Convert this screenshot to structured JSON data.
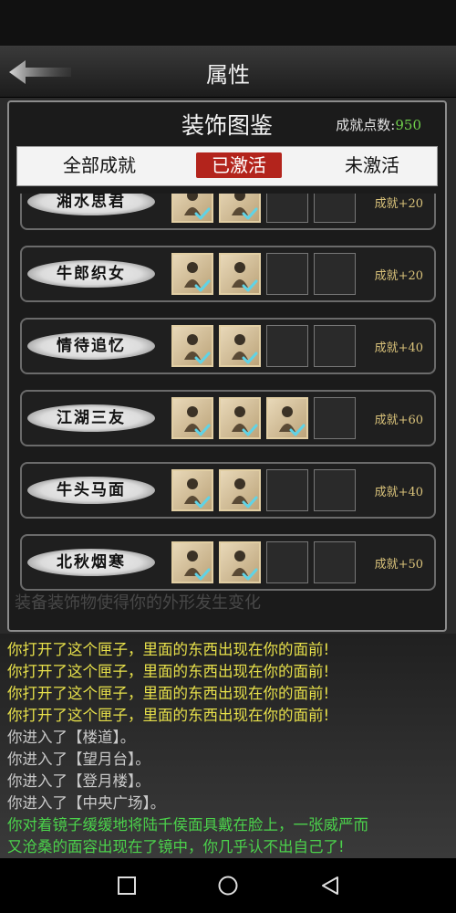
{
  "header": {
    "title": "属性"
  },
  "panel": {
    "title": "装饰图鉴",
    "points_label": "成就点数:",
    "points_value": "950",
    "ghost_text": "装备装饰物使得你的外形发生变化",
    "tabs": [
      {
        "label": "全部成就",
        "active": false
      },
      {
        "label": "已激活",
        "active": true
      },
      {
        "label": "未激活",
        "active": false
      }
    ],
    "rows": [
      {
        "name": "湘水思君",
        "reward": "成就+20",
        "slots": [
          true,
          true,
          false,
          false
        ]
      },
      {
        "name": "牛郎织女",
        "reward": "成就+20",
        "slots": [
          true,
          true,
          false,
          false
        ]
      },
      {
        "name": "情待追忆",
        "reward": "成就+40",
        "slots": [
          true,
          true,
          false,
          false
        ]
      },
      {
        "name": "江湖三友",
        "reward": "成就+60",
        "slots": [
          true,
          true,
          true,
          false
        ]
      },
      {
        "name": "牛头马面",
        "reward": "成就+40",
        "slots": [
          true,
          true,
          false,
          false
        ]
      },
      {
        "name": "北秋烟寒",
        "reward": "成就+50",
        "slots": [
          true,
          true,
          false,
          false
        ]
      }
    ]
  },
  "log": [
    {
      "text": "你打开了这个匣子，里面的东西出现在你的面前!",
      "color": "yellow"
    },
    {
      "text": "你打开了这个匣子，里面的东西出现在你的面前!",
      "color": "yellow"
    },
    {
      "text": "你打开了这个匣子，里面的东西出现在你的面前!",
      "color": "yellow"
    },
    {
      "text": "你打开了这个匣子，里面的东西出现在你的面前!",
      "color": "yellow"
    },
    {
      "text": "你进入了【楼道】。",
      "color": "gray"
    },
    {
      "text": "你进入了【望月台】。",
      "color": "gray"
    },
    {
      "text": "你进入了【登月楼】。",
      "color": "gray"
    },
    {
      "text": "你进入了【中央广场】。",
      "color": "gray"
    },
    {
      "text": "你对着镜子缓缓地将陆千侯面具戴在脸上，一张威严而",
      "color": "green"
    },
    {
      "text": "又沧桑的面容出现在了镜中，你几乎认不出自己了!",
      "color": "green"
    }
  ],
  "navbar": {
    "icons": [
      "recent-apps-icon",
      "home-icon",
      "back-icon"
    ]
  }
}
